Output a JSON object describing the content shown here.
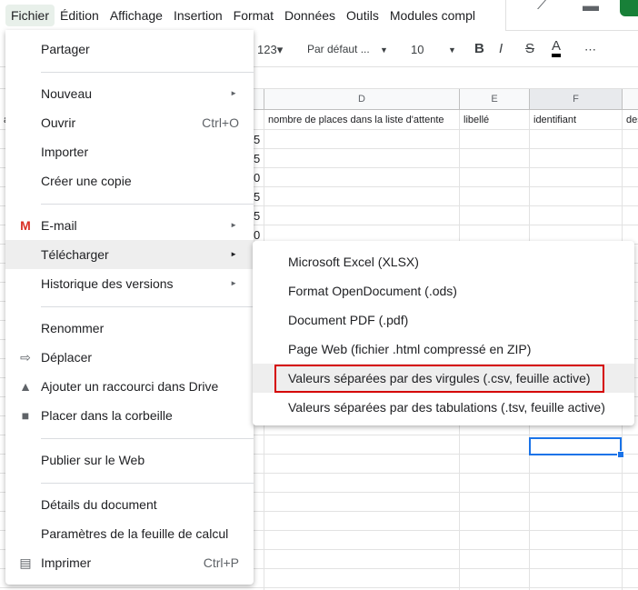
{
  "menubar": [
    "Fichier",
    "Édition",
    "Affichage",
    "Insertion",
    "Format",
    "Données",
    "Outils",
    "Modules compl"
  ],
  "toolbar": {
    "number_format": "123▾",
    "font": "Par défaut ...",
    "font_size": "10",
    "bold": "B",
    "italic": "I",
    "strike": "S",
    "text_color": "A",
    "more": "⋯"
  },
  "columns": [
    "D",
    "E",
    "F"
  ],
  "row1": {
    "c": "at",
    "d": "nombre de places dans la liste d'attente",
    "e": "libellé",
    "f": "identifiant",
    "g": "des"
  },
  "col_c_values": [
    "5",
    "5",
    "0",
    "5",
    "5",
    "0"
  ],
  "file_menu": [
    {
      "label": "Partager"
    },
    {
      "label": "Nouveau",
      "submenu": true
    },
    {
      "label": "Ouvrir",
      "shortcut": "Ctrl+O"
    },
    {
      "label": "Importer"
    },
    {
      "label": "Créer une copie"
    },
    {
      "label": "E-mail",
      "submenu": true,
      "icon": "gmail-icon"
    },
    {
      "label": "Télécharger",
      "submenu": true,
      "highlighted": true
    },
    {
      "label": "Historique des versions",
      "submenu": true
    },
    {
      "label": "Renommer"
    },
    {
      "label": "Déplacer",
      "icon": "move-folder-icon"
    },
    {
      "label": "Ajouter un raccourci dans Drive",
      "icon": "drive-shortcut-icon"
    },
    {
      "label": "Placer dans la corbeille",
      "icon": "trash-icon"
    },
    {
      "label": "Publier sur le Web"
    },
    {
      "label": "Détails du document"
    },
    {
      "label": "Paramètres de la feuille de calcul"
    },
    {
      "label": "Imprimer",
      "shortcut": "Ctrl+P",
      "icon": "print-icon"
    }
  ],
  "download_submenu": [
    {
      "label": "Microsoft Excel (XLSX)"
    },
    {
      "label": "Format OpenDocument (.ods)"
    },
    {
      "label": "Document PDF (.pdf)"
    },
    {
      "label": "Page Web (fichier .html compressé en ZIP)"
    },
    {
      "label": "Valeurs séparées par des virgules (.csv, feuille active)",
      "highlighted": true
    },
    {
      "label": "Valeurs séparées par des tabulations (.tsv, feuille active)"
    }
  ],
  "colors": {
    "highlight_box": "#d50000",
    "selection": "#1a73e8"
  }
}
